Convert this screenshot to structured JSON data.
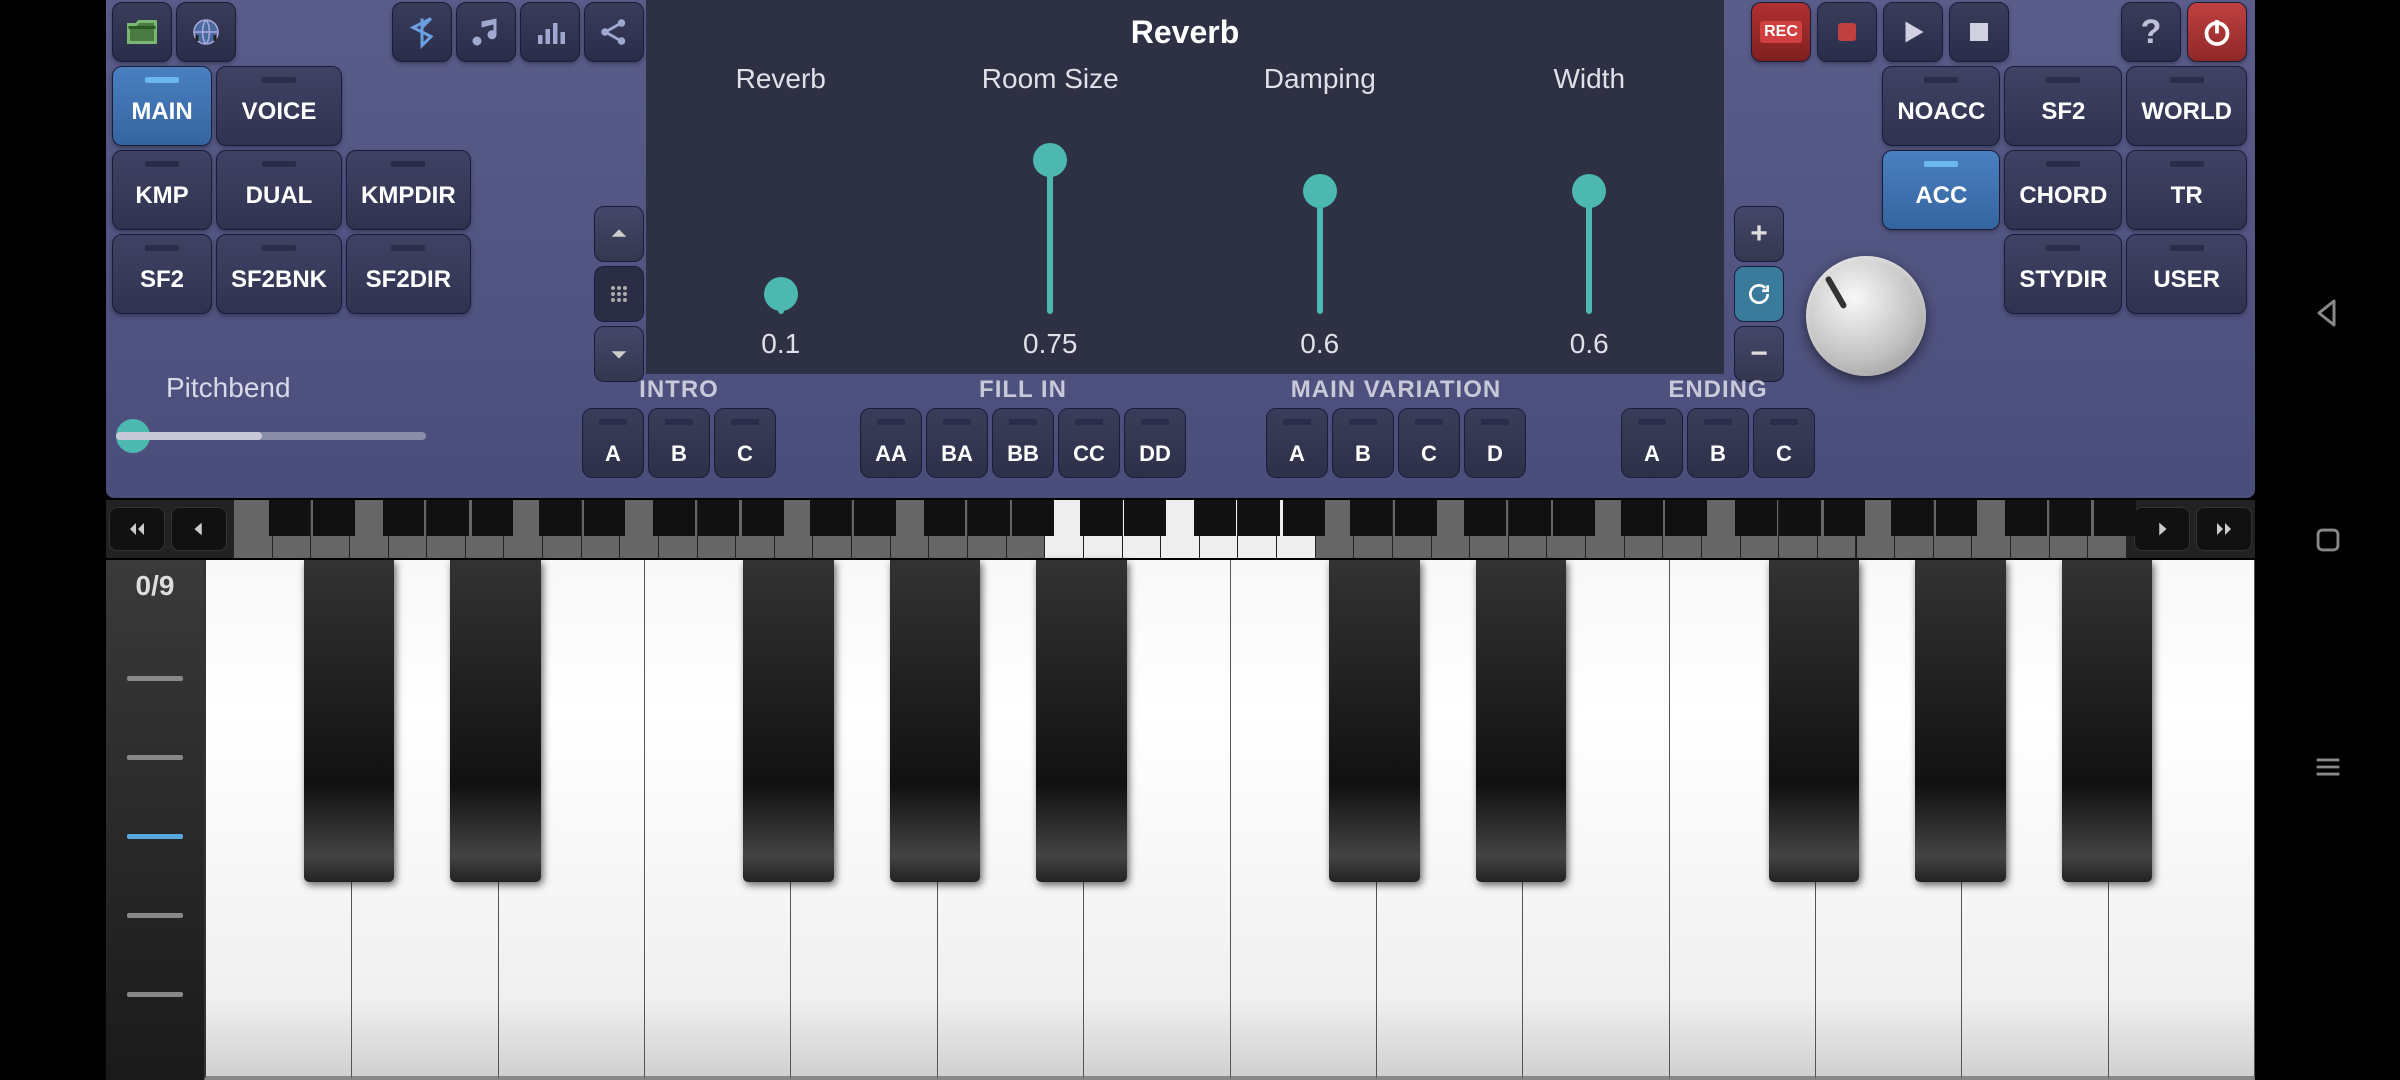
{
  "reverb_panel": {
    "title": "Reverb",
    "sliders": [
      {
        "label": "Reverb",
        "value": "0.1",
        "frac": 0.1
      },
      {
        "label": "Room Size",
        "value": "0.75",
        "frac": 0.75
      },
      {
        "label": "Damping",
        "value": "0.6",
        "frac": 0.6
      },
      {
        "label": "Width",
        "value": "0.6",
        "frac": 0.6
      }
    ]
  },
  "left_tabs": [
    {
      "label": "MAIN",
      "active": true
    },
    {
      "label": "VOICE",
      "active": false
    },
    {
      "label": "KMP",
      "active": false
    },
    {
      "label": "DUAL",
      "active": false
    },
    {
      "label": "KMPDIR",
      "active": false
    },
    {
      "label": "SF2",
      "active": false
    },
    {
      "label": "SF2BNK",
      "active": false
    },
    {
      "label": "SF2DIR",
      "active": false
    }
  ],
  "right_tabs": [
    {
      "label": "NOACC",
      "active": false
    },
    {
      "label": "SF2",
      "active": false
    },
    {
      "label": "WORLD",
      "active": false
    },
    {
      "label": "ACC",
      "active": true
    },
    {
      "label": "CHORD",
      "active": false
    },
    {
      "label": "TR",
      "active": false
    },
    {
      "label": "STYDIR",
      "active": false
    },
    {
      "label": "USER",
      "active": false
    }
  ],
  "pitchbend": {
    "label": "Pitchbend"
  },
  "pattern_sections": {
    "intro": {
      "title": "INTRO",
      "buttons": [
        "A",
        "B",
        "C"
      ]
    },
    "fillin": {
      "title": "FILL IN",
      "buttons": [
        "AA",
        "BA",
        "BB",
        "CC",
        "DD"
      ]
    },
    "mainvar": {
      "title": "MAIN VARIATION",
      "buttons": [
        "A",
        "B",
        "C",
        "D"
      ]
    },
    "ending": {
      "title": "ENDING",
      "buttons": [
        "A",
        "B",
        "C"
      ]
    }
  },
  "volume": {
    "counter": "0/9",
    "lit_index": 2,
    "ticks": 5
  },
  "keyboard": {
    "white_keys": 14,
    "overview_octaves": 7,
    "highlighted_octave_index": 3
  },
  "transport": {
    "rec_label": "REC"
  }
}
